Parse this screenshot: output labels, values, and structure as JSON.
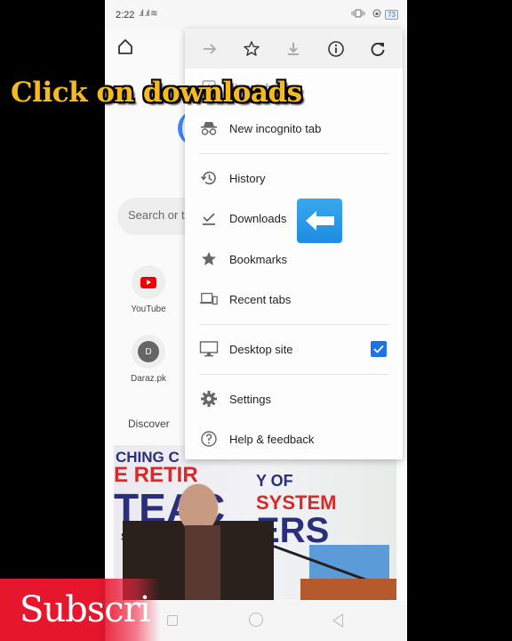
{
  "status_bar": {
    "time": "2:22",
    "signal": ".ıl .ıl ≋",
    "right_icons": "📳 ⊛",
    "battery": "73"
  },
  "overlay": {
    "caption": "Click on downloads",
    "subscribe": "Subscri",
    "arrow_color": "#2196f3"
  },
  "browser": {
    "search_placeholder": "Search or t",
    "shortcuts": [
      {
        "label": "YouTube",
        "icon": "youtube-icon"
      },
      {
        "label": "Daraz.pk",
        "letter": "D"
      }
    ],
    "discover_label": "Discover",
    "article_banner": {
      "line1": "CHING C",
      "line2": "E RETIR",
      "line3": "TEAC",
      "line4": "Sc",
      "right1": "Y OF",
      "right2": "SYSTEM",
      "right3": "ERS"
    }
  },
  "menu": {
    "toolbar": [
      {
        "name": "forward",
        "icon": "forward-arrow-icon",
        "enabled": false
      },
      {
        "name": "bookmark",
        "icon": "star-outline-icon",
        "enabled": true
      },
      {
        "name": "download-page",
        "icon": "download-icon",
        "enabled": false
      },
      {
        "name": "page-info",
        "icon": "info-icon",
        "enabled": true
      },
      {
        "name": "refresh",
        "icon": "refresh-icon",
        "enabled": true
      }
    ],
    "items": [
      {
        "label": "New tab"
      },
      {
        "label": "New incognito tab"
      },
      {
        "label": "History"
      },
      {
        "label": "Downloads"
      },
      {
        "label": "Bookmarks"
      },
      {
        "label": "Recent tabs"
      },
      {
        "label": "Desktop site",
        "checked": true
      },
      {
        "label": "Settings"
      },
      {
        "label": "Help & feedback"
      }
    ]
  },
  "colors": {
    "accent_blue": "#1a73e8",
    "caption_yellow": "#f5b921",
    "subscribe_red": "#e6162d"
  }
}
